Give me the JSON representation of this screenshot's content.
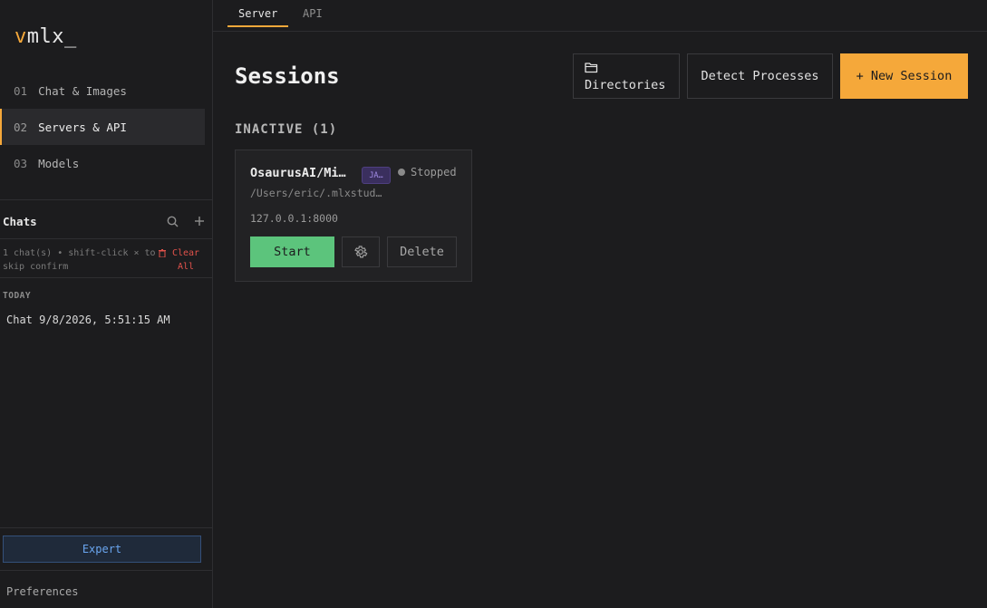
{
  "logo": {
    "v": "v",
    "rest": "mlx_"
  },
  "nav": {
    "items": [
      {
        "num": "01",
        "label": "Chat & Images"
      },
      {
        "num": "02",
        "label": "Servers & API"
      },
      {
        "num": "03",
        "label": "Models"
      }
    ]
  },
  "chats": {
    "title": "Chats",
    "hint": "1 chat(s) • shift-click × to skip confirm",
    "clear_all": "Clear All",
    "section": "TODAY",
    "items": [
      {
        "label": "Chat 9/8/2026, 5:51:15 AM"
      }
    ]
  },
  "footer": {
    "expert": "Expert",
    "preferences": "Preferences"
  },
  "tabs": [
    {
      "label": "Server"
    },
    {
      "label": "API"
    }
  ],
  "page": {
    "title": "Sessions",
    "buttons": {
      "directories": "Directories",
      "detect": "Detect Processes",
      "new_session": "+ New Session"
    },
    "section_heading": "INACTIVE (1)"
  },
  "session": {
    "name": "OsaurusAI/Mi…",
    "badge": "JA…",
    "status": "Stopped",
    "path": "/Users/eric/.mlxstud…",
    "host": "127.0.0.1:8000",
    "start": "Start",
    "delete": "Delete"
  },
  "colors": {
    "accent": "#f5a83a",
    "start": "#5cc47c",
    "danger": "#e2524b",
    "expert": "#6aa6f0"
  }
}
